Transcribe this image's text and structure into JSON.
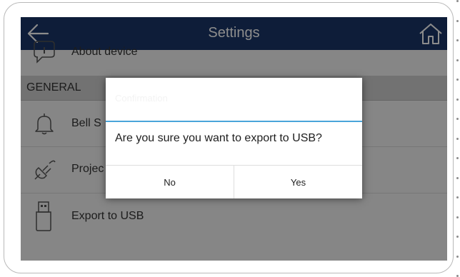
{
  "header": {
    "title": "Settings"
  },
  "list": {
    "top_item_label": "About device",
    "section_label": "GENERAL",
    "items": [
      {
        "label": "Bell S",
        "icon": "bell-icon"
      },
      {
        "label": "Projec",
        "icon": "plug-icon"
      },
      {
        "label": "Export to USB",
        "icon": "usb-icon"
      }
    ]
  },
  "dialog": {
    "title": "Confirmation",
    "message": "Are you sure you want to export to USB?",
    "no_label": "No",
    "yes_label": "Yes"
  },
  "colors": {
    "topbar": "#1a3668",
    "accent": "#4aa4da",
    "section_bg": "#cfcfcf"
  }
}
